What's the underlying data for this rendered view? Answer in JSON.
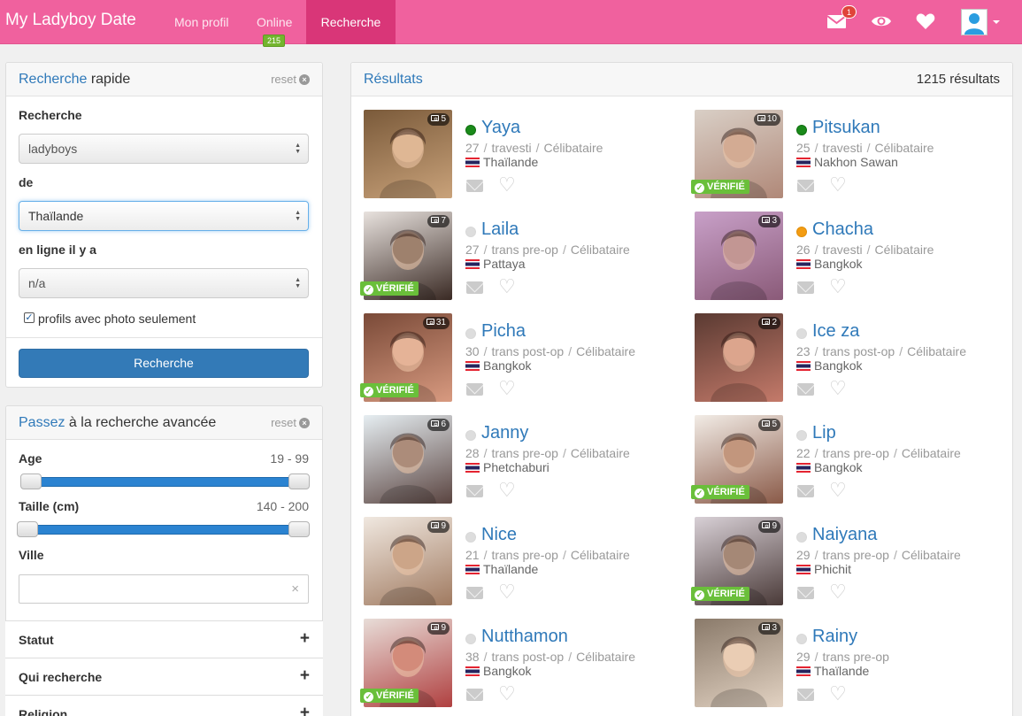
{
  "navbar": {
    "brand": "My Ladyboy Date",
    "links": [
      {
        "label": "Mon profil"
      },
      {
        "label": "Online",
        "badge": "215"
      },
      {
        "label": "Recherche",
        "active": true
      }
    ],
    "mail_badge": "1",
    "icons": [
      "envelope-icon",
      "eye-icon",
      "heart-icon",
      "user-avatar-icon"
    ],
    "accent_color": "#f0619e",
    "active_color": "#d93678"
  },
  "quick_search": {
    "title_blue": "Recherche",
    "title_rest": " rapide",
    "reset": "reset",
    "search_label": "Recherche",
    "search_value": "ladyboys",
    "from_label": "de",
    "from_value": "Thaïlande",
    "online_label": "en ligne il y a",
    "online_value": "n/a",
    "photo_only_label": "profils avec photo seulement",
    "photo_only_checked": true,
    "submit": "Recherche"
  },
  "advanced_search": {
    "title_blue": "Passez",
    "title_rest": " à la recherche avancée",
    "reset": "reset",
    "age_label": "Age",
    "age_range": "19 - 99",
    "age_min": 19,
    "age_max": 99,
    "height_label": "Taille (cm)",
    "height_range": "140 - 200",
    "height_min": 140,
    "height_max": 200,
    "city_label": "Ville",
    "city_value": "",
    "sections": [
      "Statut",
      "Qui recherche",
      "Religion"
    ]
  },
  "results": {
    "title": "Résultats",
    "count": "1215 résultats",
    "profiles": [
      {
        "name": "Yaya",
        "age": "27",
        "type": "travesti",
        "status": "Célibataire",
        "location": "Thaïlande",
        "photos": "5",
        "verified": false,
        "presence": "online"
      },
      {
        "name": "Pitsukan",
        "age": "25",
        "type": "travesti",
        "status": "Célibataire",
        "location": "Nakhon Sawan",
        "photos": "10",
        "verified": true,
        "presence": "online"
      },
      {
        "name": "Laila",
        "age": "27",
        "type": "trans pre-op",
        "status": "Célibataire",
        "location": "Pattaya",
        "photos": "7",
        "verified": true,
        "presence": "offline"
      },
      {
        "name": "Chacha",
        "age": "26",
        "type": "travesti",
        "status": "Célibataire",
        "location": "Bangkok",
        "photos": "3",
        "verified": false,
        "presence": "away"
      },
      {
        "name": "Picha",
        "age": "30",
        "type": "trans post-op",
        "status": "Célibataire",
        "location": "Bangkok",
        "photos": "31",
        "verified": true,
        "presence": "offline"
      },
      {
        "name": "Ice za",
        "age": "23",
        "type": "trans post-op",
        "status": "Célibataire",
        "location": "Bangkok",
        "photos": "2",
        "verified": false,
        "presence": "offline"
      },
      {
        "name": "Janny",
        "age": "28",
        "type": "trans pre-op",
        "status": "Célibataire",
        "location": "Phetchaburi",
        "photos": "6",
        "verified": false,
        "presence": "offline"
      },
      {
        "name": "Lip",
        "age": "22",
        "type": "trans pre-op",
        "status": "Célibataire",
        "location": "Bangkok",
        "photos": "5",
        "verified": true,
        "presence": "offline"
      },
      {
        "name": "Nice",
        "age": "21",
        "type": "trans pre-op",
        "status": "Célibataire",
        "location": "Thaïlande",
        "photos": "9",
        "verified": false,
        "presence": "offline"
      },
      {
        "name": "Naiyana",
        "age": "29",
        "type": "trans pre-op",
        "status": "Célibataire",
        "location": "Phichit",
        "photos": "9",
        "verified": true,
        "presence": "offline"
      },
      {
        "name": "Nutthamon",
        "age": "38",
        "type": "trans post-op",
        "status": "Célibataire",
        "location": "Bangkok",
        "photos": "9",
        "verified": true,
        "presence": "offline"
      },
      {
        "name": "Rainy",
        "age": "29",
        "type": "trans pre-op",
        "status": "",
        "location": "Thaïlande",
        "photos": "3",
        "verified": false,
        "presence": "offline"
      }
    ],
    "verified_label": "VÉRIFIÉ"
  }
}
